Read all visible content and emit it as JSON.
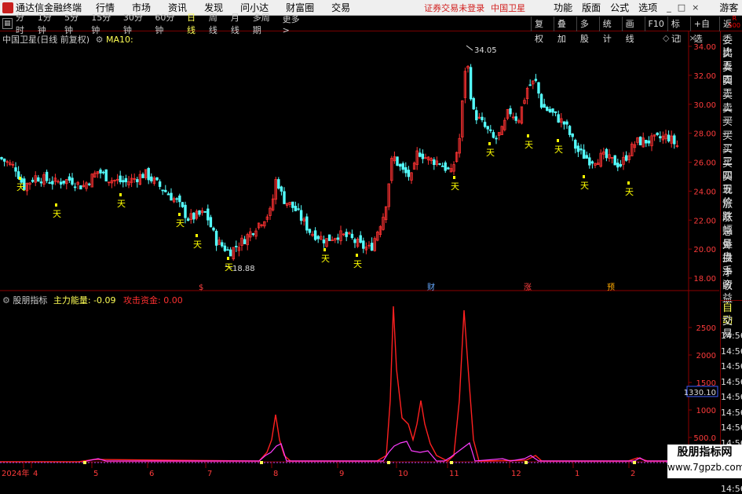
{
  "menubar": {
    "app_title": "通达信金融终端",
    "menus": [
      "行情",
      "市场",
      "资讯",
      "发现",
      "问小达",
      "财富圈",
      "交易"
    ],
    "status_text": "证券交易未登录",
    "stock_name": "中国卫星",
    "right_menus": [
      "功能",
      "版面",
      "公式",
      "选项"
    ],
    "window_controls": [
      "_",
      "□",
      "×"
    ],
    "guest_label": "游客"
  },
  "toolbar": {
    "periods": [
      "分时",
      "1分钟",
      "5分钟",
      "15分钟",
      "30分钟",
      "60分钟",
      "日线",
      "周线",
      "月线",
      "多周期",
      "更多 >"
    ],
    "active_period": "日线",
    "right_buttons": [
      "复权",
      "叠加",
      "多股",
      "统计",
      "画线",
      "F10",
      "标记",
      "+自选",
      "返回"
    ],
    "corner_r": "R",
    "corner_num": "500"
  },
  "main_chart": {
    "title": "中国卫星(日线 前复权)",
    "indicator": "MA10:",
    "price_axis": [
      "34.00",
      "32.00",
      "30.00",
      "28.00",
      "26.00",
      "24.00",
      "22.00",
      "20.00",
      "18.00"
    ],
    "high_label": "34.05",
    "low_label": "18.88",
    "signal_label": "天",
    "event_markers": [
      "$",
      "财",
      "涨",
      "预"
    ]
  },
  "sub_chart": {
    "title": "股朋指标",
    "series1_name": "主力能量",
    "series1_value": ": -0.09",
    "series2_name": "攻击资金",
    "series2_value": ": 0.00",
    "axis": [
      "2500",
      "2000",
      "1500",
      "1000",
      "500.0"
    ],
    "current_value": "1330.10"
  },
  "time_axis": [
    "2024年",
    "4",
    "5",
    "6",
    "7",
    "8",
    "9",
    "10",
    "11",
    "12",
    "1",
    "2"
  ],
  "right_panel": {
    "items": [
      "委比",
      "卖五",
      "卖四",
      "卖三",
      "卖二",
      "卖一",
      "买一",
      "买二",
      "买三",
      "买四",
      "买五",
      "现价",
      "涨跌",
      "涨幅",
      "总量",
      "外盘",
      "换手",
      "净资",
      "收益"
    ],
    "tabs": [
      "自动",
      "交易"
    ],
    "times": [
      "14:56",
      "14:56",
      "14:56",
      "14:56",
      "14:56",
      "14:56",
      "14:56",
      "14:56",
      "14:56",
      "14:56",
      "14:56"
    ]
  },
  "watermark": {
    "line1": "股朋指标网",
    "line2": "www.7gpzb.com"
  },
  "colors": {
    "up": "#ff3232",
    "down": "#54ffff",
    "signal": "#ffff00",
    "energy": "#ff2020",
    "attack": "#ff3cff"
  }
}
